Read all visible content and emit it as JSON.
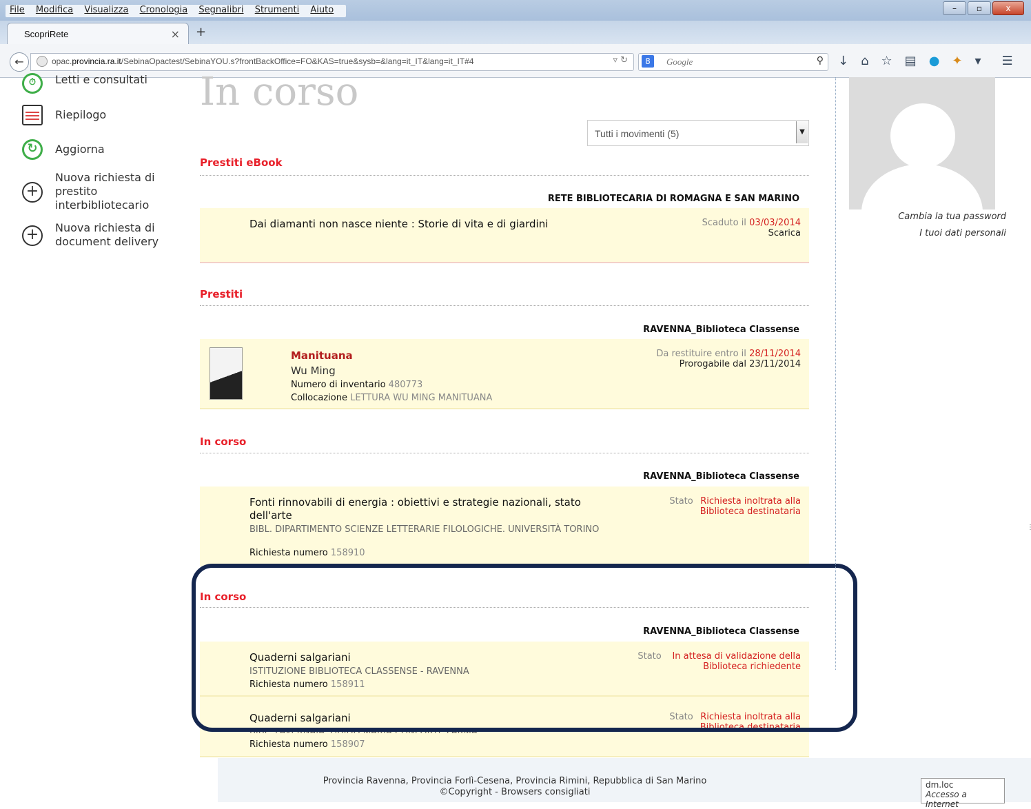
{
  "menubar": {
    "items": [
      "File",
      "Modifica",
      "Visualizza",
      "Cronologia",
      "Segnalibri",
      "Strumenti",
      "Aiuto"
    ]
  },
  "window_buttons": {
    "minimize": "–",
    "maximize": "▫",
    "close": "x"
  },
  "tab": {
    "title": "ScopriRete",
    "close": "×",
    "new_tab": "+"
  },
  "nav": {
    "url_prefix": "opac.",
    "url_host": "provincia.ra.it",
    "url_rest": "/SebinaOpactest/SebinaYOU.s?frontBackOffice=FO&KAS=true&sysb=&lang=it_IT&lang=it_IT#4",
    "search_placeholder": "Google"
  },
  "sidebar": {
    "items": [
      {
        "label": "Letti e consultati",
        "icon": "clock-icon"
      },
      {
        "label": "Riepilogo",
        "icon": "abacus-icon"
      },
      {
        "label": "Aggiorna",
        "icon": "refresh-icon"
      },
      {
        "label": "Nuova richiesta di prestito interbibliotecario",
        "icon": "plus-circle-icon"
      },
      {
        "label": "Nuova richiesta di document delivery",
        "icon": "plus-circle-icon"
      }
    ]
  },
  "page": {
    "title": "In corso",
    "filter": {
      "selected": "Tutti i movimenti (5)"
    }
  },
  "sections": {
    "ebook": {
      "heading": "Prestiti eBook",
      "library": "RETE BIBLIOTECARIA DI ROMAGNA E SAN MARINO",
      "item": {
        "title": "Dai diamanti non nasce niente : Storie di vita e di giardini",
        "status_label": "Scaduto il",
        "status_date": "03/03/2014",
        "action": "Scarica"
      }
    },
    "loans": {
      "heading": "Prestiti",
      "library": "RAVENNA_Biblioteca Classense",
      "item": {
        "title": "Manituana",
        "author": "Wu Ming",
        "inventory_label": "Numero di inventario",
        "inventory": "480773",
        "location_label": "Collocazione",
        "location": "LETTURA WU MING MANITUANA",
        "due_label": "Da restituire entro il",
        "due_date": "28/11/2014",
        "renew": "Prorogabile dal 23/11/2014"
      }
    },
    "ill1": {
      "heading": "In corso",
      "library": "RAVENNA_Biblioteca Classense",
      "item": {
        "title": "Fonti rinnovabili di energia : obiettivi e strategie nazionali, stato dell'arte",
        "library_line": "BIBL. DIPARTIMENTO SCIENZE LETTERARIE FILOLOGICHE. UNIVERSITÀ TORINO",
        "req_label": "Richiesta numero",
        "req_no": "158910",
        "status_label": "Stato",
        "status": "Richiesta inoltrata alla Biblioteca destinataria"
      }
    },
    "ill2": {
      "heading": "In corso",
      "library": "RAVENNA_Biblioteca Classense",
      "items": [
        {
          "title": "Quaderni salgariani",
          "library_line": "ISTITUZIONE BIBLIOTECA CLASSENSE - RAVENNA",
          "req_label": "Richiesta numero",
          "req_no": "158911",
          "status_label": "Stato",
          "status": "In attesa di validazione della Biblioteca richiedente"
        },
        {
          "title": "Quaderni salgariani",
          "library_line": "BIBL. FAVERNAIA. GUIDO MARIA CONFORTI. PARMA",
          "req_label": "Richiesta numero",
          "req_no": "158907",
          "status_label": "Stato",
          "status": "Richiesta inoltrata alla Biblioteca destinataria"
        }
      ]
    }
  },
  "right_panel": {
    "change_password": "Cambia la tua password",
    "personal_data": "I tuoi dati personali"
  },
  "footer": {
    "line1": "Provincia Ravenna, Provincia Forlì-Cesena, Provincia Rimini, Repubblica di San Marino",
    "line2": "©Copyright  -  Browsers consigliati"
  },
  "statusbar": {
    "host": "dm.loc",
    "zone": "Accesso a Internet"
  },
  "colors": {
    "accent_red": "#e8202a",
    "card_bg": "#fffbdc",
    "highlight": "#14264e"
  }
}
